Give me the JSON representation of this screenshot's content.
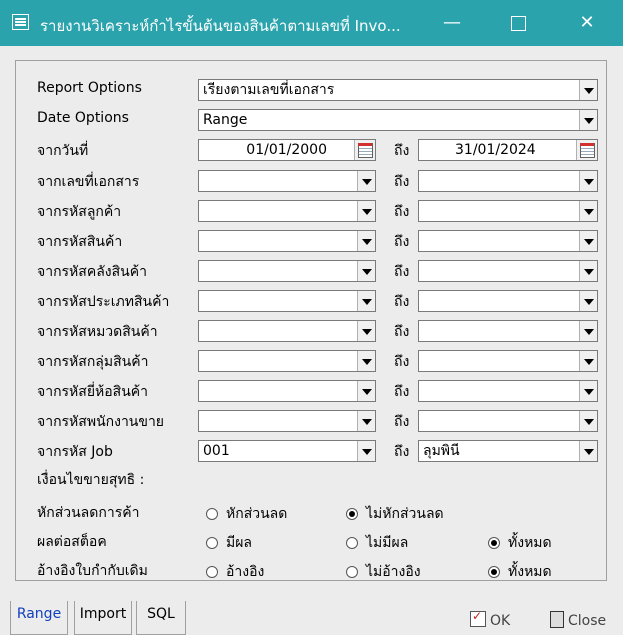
{
  "window": {
    "title": "รายงานวิเคราะห์กำไรขั้นต้นของสินค้าตามเลขที่ Invo...",
    "minimize_icon": "minimize-icon",
    "maximize_icon": "maximize-icon",
    "close_glyph": "✕"
  },
  "form": {
    "report_options": {
      "label": "Report Options",
      "value": "เรียงตามเลขที่เอกสาร"
    },
    "date_options": {
      "label": "Date Options",
      "value": "Range"
    },
    "date": {
      "label": "จากวันที่",
      "from": "01/01/2000",
      "to_label": "ถึง",
      "to": "31/01/2024"
    },
    "ranges": [
      {
        "label": "จากเลขที่เอกสาร",
        "to_label": "ถึง",
        "from": "",
        "to": ""
      },
      {
        "label": "จากรหัสลูกค้า",
        "to_label": "ถึง",
        "from": "",
        "to": ""
      },
      {
        "label": "จากรหัสสินค้า",
        "to_label": "ถึง",
        "from": "",
        "to": ""
      },
      {
        "label": "จากรหัสคลังสินค้า",
        "to_label": "ถึง",
        "from": "",
        "to": ""
      },
      {
        "label": "จากรหัสประเภทสินค้า",
        "to_label": "ถึง",
        "from": "",
        "to": ""
      },
      {
        "label": "จากรหัสหมวดสินค้า",
        "to_label": "ถึง",
        "from": "",
        "to": ""
      },
      {
        "label": "จากรหัสกลุ่มสินค้า",
        "to_label": "ถึง",
        "from": "",
        "to": ""
      },
      {
        "label": "จากรหัสยี่ห้อสินค้า",
        "to_label": "ถึง",
        "from": "",
        "to": ""
      },
      {
        "label": "จากรหัสพนักงานขาย",
        "to_label": "ถึง",
        "from": "",
        "to": ""
      },
      {
        "label": "จากรหัส Job",
        "to_label": "ถึง",
        "from": "001",
        "to": "ลุมพินี"
      }
    ],
    "net_sales_condition_label": "เงื่อนไขขายสุทธิ :",
    "options": [
      {
        "label": "หักส่วนลดการค้า",
        "choices": [
          "หักส่วนลด",
          "ไม่หักส่วนลด"
        ],
        "selected": 1
      },
      {
        "label": "ผลต่อสต็อค",
        "choices": [
          "มีผล",
          "ไม่มีผล",
          "ทั้งหมด"
        ],
        "selected": 2
      },
      {
        "label": "อ้างอิงใบกำกับเดิม",
        "choices": [
          "อ้างอิง",
          "ไม่อ้างอิง",
          "ทั้งหมด"
        ],
        "selected": 2
      }
    ]
  },
  "tabs": [
    "Range",
    "Import",
    "SQL"
  ],
  "buttons": {
    "ok": "OK",
    "close": "Close"
  }
}
